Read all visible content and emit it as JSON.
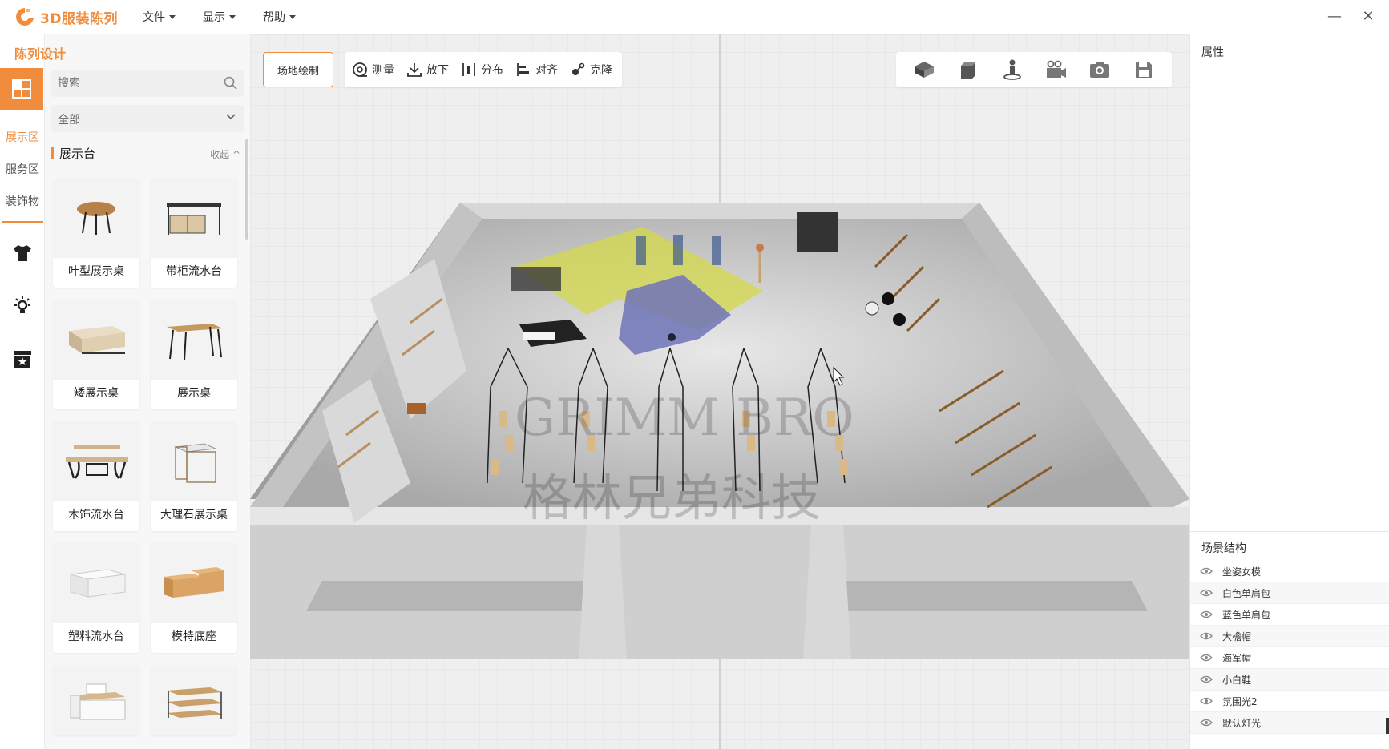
{
  "app": {
    "title": "3D服装陈列",
    "accent": "#f08c3c"
  },
  "menu": [
    {
      "label": "文件"
    },
    {
      "label": "显示"
    },
    {
      "label": "帮助"
    }
  ],
  "window_controls": {
    "minimize": "—",
    "close": "✕"
  },
  "left_rail": {
    "title": "陈列设计",
    "tabs": [
      {
        "label": "展示区",
        "active": true
      },
      {
        "label": "服务区",
        "active": false
      },
      {
        "label": "装饰物",
        "active": false
      }
    ],
    "icons": [
      "layout-icon",
      "tshirt-icon",
      "light-icon",
      "storage-box-icon"
    ]
  },
  "catalog": {
    "search_placeholder": "搜索",
    "filter_value": "全部",
    "section_title": "展示台",
    "collapse_label": "收起",
    "items": [
      {
        "label": "叶型展示桌",
        "icon": "leaf-table-icon"
      },
      {
        "label": "带柜流水台",
        "icon": "cabinet-table-icon"
      },
      {
        "label": "矮展示桌",
        "icon": "low-table-icon"
      },
      {
        "label": "展示桌",
        "icon": "display-table-icon"
      },
      {
        "label": "木饰流水台",
        "icon": "wood-table-icon"
      },
      {
        "label": "大理石展示桌",
        "icon": "marble-table-icon"
      },
      {
        "label": "塑料流水台",
        "icon": "plastic-table-icon"
      },
      {
        "label": "模特底座",
        "icon": "model-base-icon"
      },
      {
        "label": "",
        "icon": "island-table-icon"
      },
      {
        "label": "",
        "icon": "shelf-table-icon"
      }
    ]
  },
  "viewport": {
    "site_button": "场地绘制",
    "tools": [
      {
        "label": "测量",
        "icon": "measure-icon"
      },
      {
        "label": "放下",
        "icon": "drop-icon"
      },
      {
        "label": "分布",
        "icon": "distribute-icon"
      },
      {
        "label": "对齐",
        "icon": "align-icon"
      },
      {
        "label": "克隆",
        "icon": "clone-icon"
      }
    ],
    "view_tools": [
      "perspective-view-icon",
      "top-view-icon",
      "walk-view-icon",
      "video-camera-icon",
      "screenshot-camera-icon",
      "save-icon"
    ],
    "watermark_text": "GRIMM BRO",
    "watermark_cn": "格林兄弟科技"
  },
  "properties": {
    "title": "属性"
  },
  "scene": {
    "title": "场景结构",
    "items": [
      "坐姿女模",
      "白色单肩包",
      "蓝色单肩包",
      "大檐帽",
      "海军帽",
      "小白鞋",
      "氛围光2",
      "默认灯光"
    ]
  }
}
